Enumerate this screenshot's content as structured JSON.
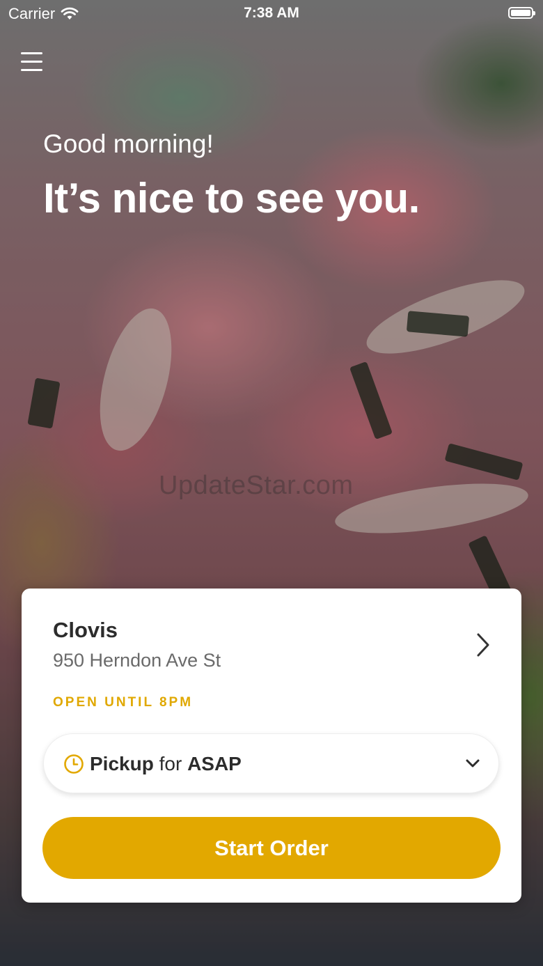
{
  "status_bar": {
    "carrier": "Carrier",
    "time": "7:38 AM"
  },
  "hero": {
    "greeting": "Good morning!",
    "headline": "It’s nice to see you.",
    "watermark": "UpdateStar.com"
  },
  "store_card": {
    "name": "Clovis",
    "address": "950 Herndon Ave St",
    "hours": "OPEN UNTIL 8PM",
    "pickup": {
      "mode": "Pickup",
      "connector": "for",
      "time": "ASAP"
    },
    "start_button": "Start Order"
  },
  "colors": {
    "accent": "#E2A800",
    "hours_text": "#E0A800",
    "card_bg": "#FFFFFF"
  },
  "icons": [
    "wifi-icon",
    "battery-icon",
    "menu-icon",
    "chevron-right-icon",
    "clock-icon",
    "chevron-down-icon"
  ]
}
